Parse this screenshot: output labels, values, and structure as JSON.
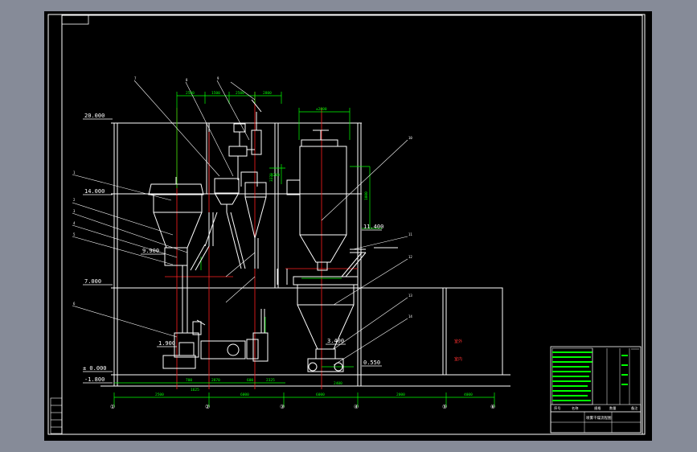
{
  "viewer": {
    "background_color": "#868b98",
    "canvas_color": "#000000"
  },
  "colors": {
    "frame": "#ffffff",
    "dimension": "#00ff00",
    "centerline": "#ff0000",
    "equipment": "#ffffff",
    "leader": "#ffffff",
    "note_text": "#ff3030"
  },
  "elevations": [
    "20.000",
    "14.000",
    "9.900",
    "7.000",
    "1.900",
    "± 0.000",
    "-1.800",
    "11.400",
    "3.400",
    "0.550"
  ],
  "top_dimensions": [
    "2500",
    "1500",
    "2500",
    "2800",
    "±2000"
  ],
  "vertical_dimensions": [
    "1200",
    "3370",
    "1000"
  ],
  "bottom_dimensions_row1": [
    "700",
    "1625",
    "2870",
    "600",
    "2325",
    "2400"
  ],
  "bottom_dimensions_row2": [
    "2500",
    "6000",
    "6000",
    "2000",
    "4000"
  ],
  "axis_labels": [
    "①",
    "②",
    "③",
    "④",
    "⑤",
    "⑥"
  ],
  "room_labels": [
    "室外",
    "室内"
  ],
  "title_block": {
    "drawing_title": "喷雾干燥流程图",
    "header_cells": [
      "序号",
      "名称",
      "规格",
      "数量",
      "备注"
    ]
  }
}
